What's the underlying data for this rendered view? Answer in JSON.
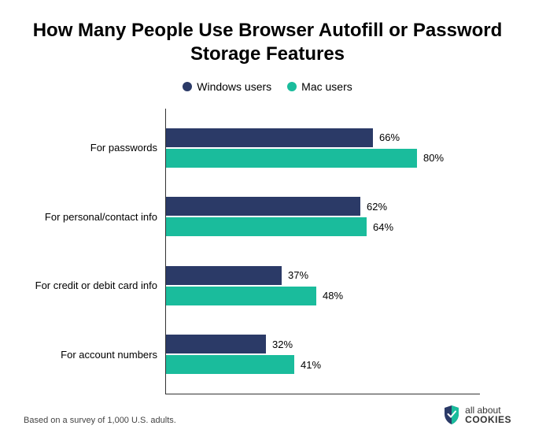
{
  "chart_data": {
    "type": "bar",
    "orientation": "horizontal",
    "title": "How Many People Use Browser Autofill or Password Storage Features",
    "categories": [
      "For passwords",
      "For personal/contact info",
      "For credit or debit card info",
      "For account numbers"
    ],
    "series": [
      {
        "name": "Windows users",
        "color": "#2b3a67",
        "values": [
          66,
          62,
          37,
          32
        ]
      },
      {
        "name": "Mac users",
        "color": "#1abc9c",
        "values": [
          80,
          64,
          48,
          41
        ]
      }
    ],
    "xlim": [
      0,
      100
    ],
    "value_suffix": "%"
  },
  "footnote": "Based on a survey of 1,000 U.S. adults.",
  "logo": {
    "line1": "all about",
    "line2": "COOKIES"
  }
}
